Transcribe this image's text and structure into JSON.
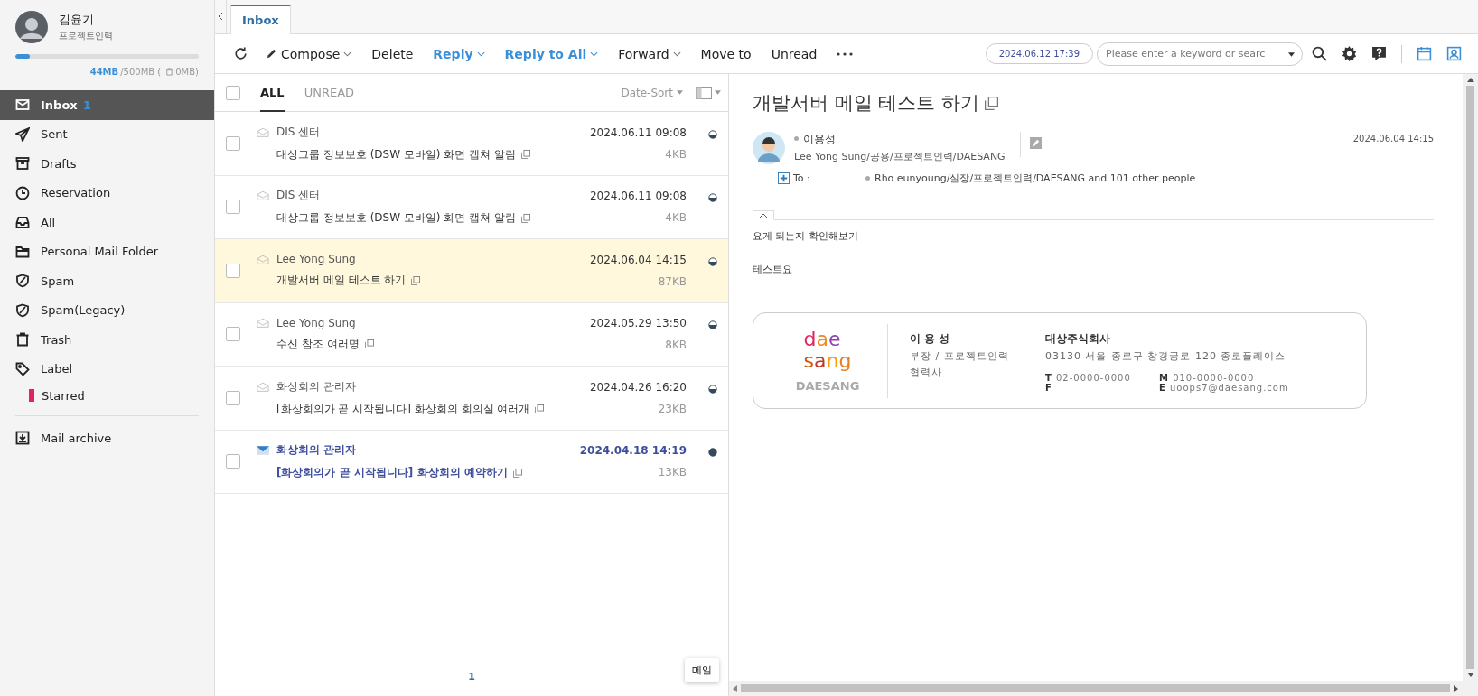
{
  "user": {
    "name": "김윤기",
    "dept": "프로젝트인력",
    "quota_used": "44MB",
    "quota_total": "/500MB (",
    "quota_trash": "0MB)",
    "level": 0.08
  },
  "folders": [
    {
      "kind": "inbox",
      "label": "Inbox",
      "count": "1",
      "selected": true
    },
    {
      "kind": "sent",
      "label": "Sent",
      "selected": false
    },
    {
      "kind": "drafts",
      "label": "Drafts",
      "selected": false
    },
    {
      "kind": "reservation",
      "label": "Reservation",
      "selected": false
    },
    {
      "kind": "all",
      "label": "All",
      "selected": false
    },
    {
      "kind": "folder",
      "label": "Personal Mail Folder",
      "selected": false
    },
    {
      "kind": "spam",
      "label": "Spam",
      "selected": false
    },
    {
      "kind": "spam",
      "label": "Spam(Legacy)",
      "selected": false
    },
    {
      "kind": "trash",
      "label": "Trash",
      "selected": false
    },
    {
      "kind": "label",
      "label": "Label",
      "selected": false,
      "children": [
        {
          "label": "Starred",
          "color": "#e0245e",
          "selected": false
        }
      ]
    }
  ],
  "archive": {
    "label": "Mail archive"
  },
  "tabs": [
    {
      "label": "Inbox",
      "selected": true
    }
  ],
  "toolbar": [
    {
      "label": "Compose",
      "kind": "compose",
      "caret": true,
      "highlight": false
    },
    {
      "label": "Delete",
      "kind": "plain",
      "caret": false,
      "highlight": false
    },
    {
      "label": "Reply",
      "kind": "plain",
      "caret": true,
      "highlight": true
    },
    {
      "label": "Reply to All",
      "kind": "plain",
      "caret": true,
      "highlight": true
    },
    {
      "label": "Forward",
      "kind": "plain",
      "caret": true,
      "highlight": false
    },
    {
      "label": "Move to",
      "kind": "plain",
      "caret": false,
      "highlight": false
    },
    {
      "label": "Unread",
      "kind": "plain",
      "caret": false,
      "highlight": false
    }
  ],
  "datetime": "2024.06.12 17:39",
  "search": {
    "placeholder": "Please enter a keyword or searc"
  },
  "list": {
    "all_checked": false,
    "filters": [
      {
        "label": "ALL",
        "selected": true
      },
      {
        "label": "UNREAD",
        "selected": false
      }
    ],
    "sort": "Date-Sort",
    "rows": [
      {
        "sender": "DIS 센터",
        "subject": "대상그룹 정보보호 (DSW 모바일) 화면 캡쳐 알림",
        "date": "2024.06.11 09:08",
        "size": "4KB",
        "unread": false,
        "selected": false,
        "checked": false
      },
      {
        "sender": "DIS 센터",
        "subject": "대상그룹 정보보호 (DSW 모바일) 화면 캡쳐 알림",
        "date": "2024.06.11 09:08",
        "size": "4KB",
        "unread": false,
        "selected": false,
        "checked": false
      },
      {
        "sender": "Lee Yong Sung",
        "subject": "개발서버 메일 테스트 하기",
        "date": "2024.06.04 14:15",
        "size": "87KB",
        "unread": false,
        "selected": true,
        "checked": false
      },
      {
        "sender": "Lee Yong Sung",
        "subject": "수신 참조 여러명",
        "date": "2024.05.29 13:50",
        "size": "8KB",
        "unread": false,
        "selected": false,
        "checked": false
      },
      {
        "sender": "화상회의 관리자",
        "subject": "[화상회의가 곧 시작됩니다] 화상회의 회의실 여러개",
        "date": "2024.04.26 16:20",
        "size": "23KB",
        "unread": false,
        "selected": false,
        "checked": false
      },
      {
        "sender": "화상회의 관리자",
        "subject": "[화상회의가 곧 시작됩니다] 화상회의 예약하기",
        "date": "2024.04.18 14:19",
        "size": "13KB",
        "unread": true,
        "selected": false,
        "checked": false
      }
    ],
    "page": "1",
    "float_button": "메일"
  },
  "message": {
    "title": "개발서버 메일 테스트 하기",
    "sender_name": "이용성",
    "sender_detail": "Lee Yong Sung/공용/프로젝트인력/DAESANG",
    "date": "2024.06.04 14:15",
    "to_label": "To :",
    "to": "Rho eunyoung/실장/프로젝트인력/DAESANG and 101 other people",
    "body": [
      "요게 되는지 확인해보기",
      "테스트요"
    ],
    "signature": {
      "logo_mark": [
        "dae",
        "sang"
      ],
      "logo_word": "DAESANG",
      "name": "이 용 성",
      "position": "부장 / 프로젝트인력",
      "affiliation": "협력사",
      "company": "대상주식회사",
      "address": "03130 서울 종로구 창경궁로 120 종로플레이스",
      "contacts": [
        {
          "key": "T",
          "value": "02-0000-0000"
        },
        {
          "key": "M",
          "value": "010-0000-0000"
        },
        {
          "key": "F"
        },
        {
          "key": "E",
          "value": "uoops7@daesang.com"
        }
      ]
    }
  }
}
